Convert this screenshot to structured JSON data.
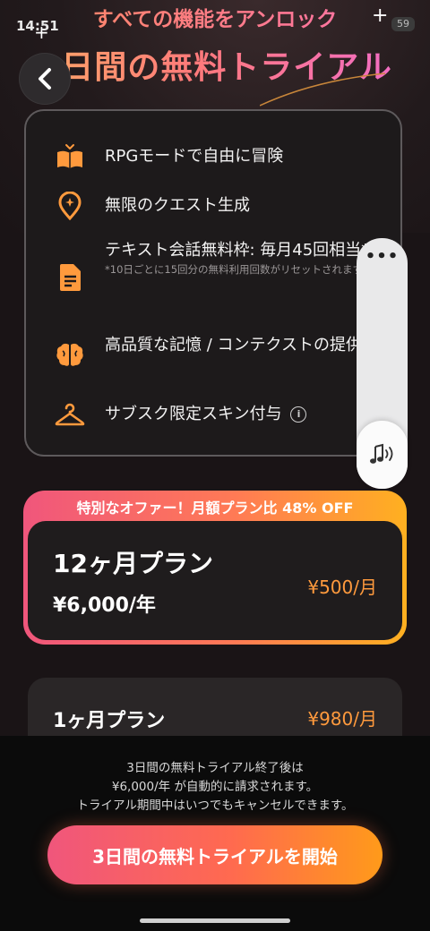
{
  "status": {
    "time": "14:51",
    "battery": "59"
  },
  "header": {
    "tagline": "すべての機能をアンロック",
    "headline": "3日間の無料トライアル"
  },
  "features": [
    {
      "icon": "open-book-icon",
      "text": "RPGモードで自由に冒険"
    },
    {
      "icon": "location-pin-sparkle-icon",
      "text": "無限のクエスト生成"
    },
    {
      "icon": "document-icon",
      "text": "テキスト会話無料枠: 毎月45回相当*",
      "note": "*10日ごとに15回分の無料利用回数がリセットされます"
    },
    {
      "icon": "brain-icon",
      "text": "高品質な記憶 / コンテクストの提供"
    },
    {
      "icon": "hanger-icon",
      "text": "サブスク限定スキン付与",
      "info": "i"
    }
  ],
  "overlay": {
    "menu_dots": "•••"
  },
  "offer": {
    "banner": "特別なオファー！月額プラン比 48% OFF"
  },
  "plans": [
    {
      "name": "12ヶ月プラン",
      "price": "¥6,000/年",
      "monthly": "¥500/月",
      "selected": true
    },
    {
      "name": "1ヶ月プラン",
      "monthly": "¥980/月",
      "selected": false
    }
  ],
  "disclaimer": [
    "3日間の無料トライアル終了後は",
    "¥6,000/年 が自動的に請求されます。",
    "トライアル期間中はいつでもキャンセルできます。"
  ],
  "cta": {
    "label": "3日間の無料トライアルを開始"
  },
  "colors": {
    "accent_orange": "#ff9a3d",
    "gradient_pink": "#f0567c",
    "gradient_orange": "#ff9a1a"
  }
}
